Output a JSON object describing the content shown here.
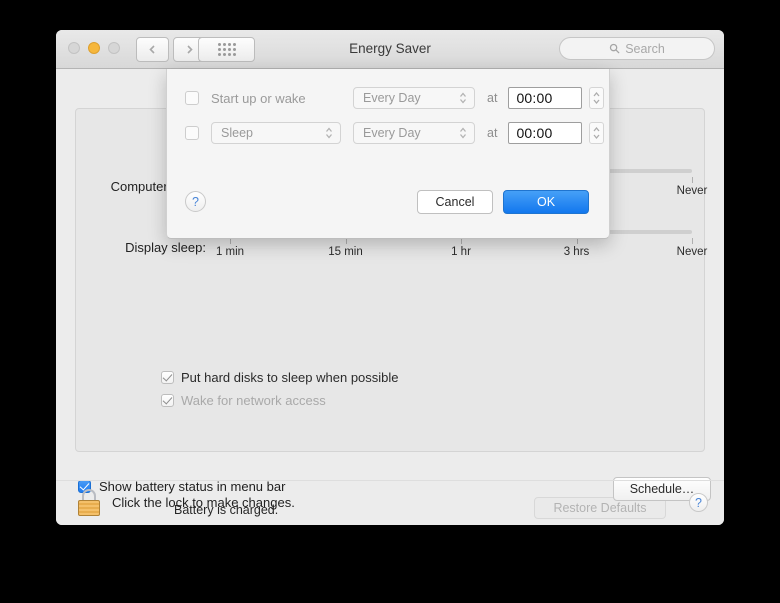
{
  "window": {
    "title": "Energy Saver",
    "traffic_lights": [
      "close-grey",
      "minimize-yellow",
      "zoom-grey"
    ],
    "nav": {
      "back": "‹",
      "forward": "›",
      "show_all": "grid-icon"
    },
    "search": {
      "placeholder": "Search",
      "value": "",
      "icon": "search-icon"
    }
  },
  "main": {
    "computer_sleep_label": "Computer sleep:",
    "display_sleep_label": "Display sleep:",
    "slider_tick_labels": [
      "1 min",
      "15 min",
      "1 hr",
      "3 hrs",
      "Never"
    ],
    "checkboxes": [
      {
        "label": "Put hard disks to sleep when possible",
        "checked": true,
        "enabled": true
      },
      {
        "label": "Wake for network access",
        "checked": true,
        "enabled": false
      }
    ],
    "battery_status": "Battery is charged.",
    "restore_defaults_label": "Restore Defaults",
    "restore_defaults_enabled": false,
    "show_battery_label": "Show battery status in menu bar",
    "show_battery_checked": true,
    "schedule_label": "Schedule…",
    "lock_text": "Click the lock to make changes.",
    "lock_icon": "locked-padlock-icon",
    "help_label": "?"
  },
  "sheet": {
    "rows": [
      {
        "checked": false,
        "label": "Start up or wake",
        "action": null,
        "frequency": "Every Day",
        "at_label": "at",
        "time": "00:00"
      },
      {
        "checked": false,
        "label": null,
        "action": "Sleep",
        "frequency": "Every Day",
        "at_label": "at",
        "time": "00:00"
      }
    ],
    "help_label": "?",
    "cancel_label": "Cancel",
    "ok_label": "OK"
  },
  "colors": {
    "accent_blue": "#1277ee",
    "minimize_yellow": "#f6b73c",
    "lock_gold": "#e8ad4e"
  }
}
